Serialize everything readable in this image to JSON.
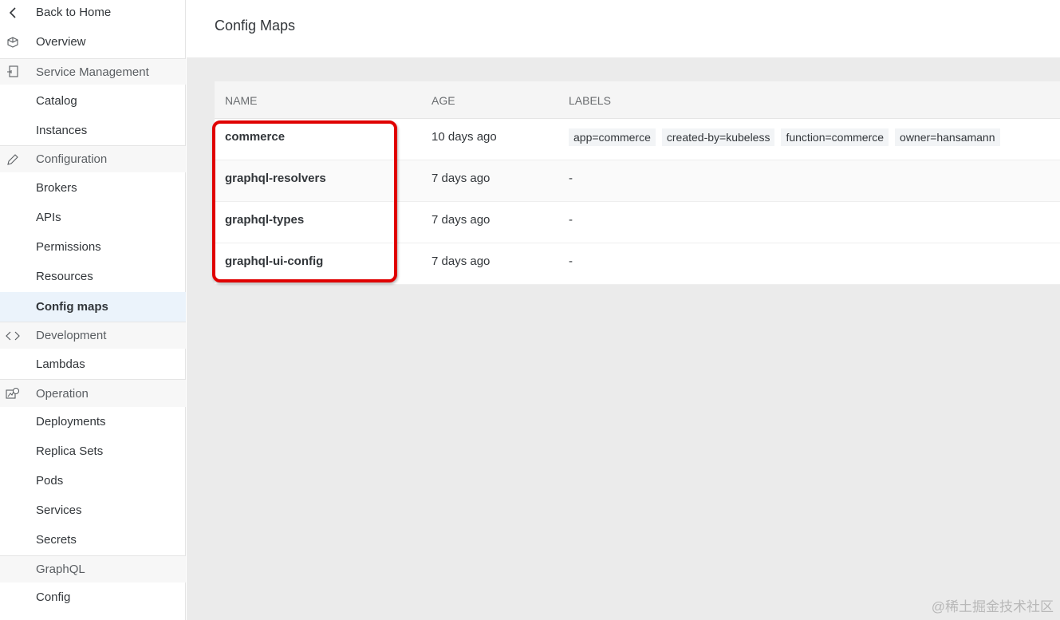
{
  "sidebar": {
    "items": [
      {
        "label": "Back to Home",
        "icon": "chevron-left-icon"
      },
      {
        "label": "Overview",
        "icon": "cube-icon"
      },
      {
        "label": "Service Management",
        "icon": "service-icon"
      },
      {
        "label": "Catalog"
      },
      {
        "label": "Instances"
      },
      {
        "label": "Configuration",
        "icon": "edit-icon"
      },
      {
        "label": "Brokers"
      },
      {
        "label": "APIs"
      },
      {
        "label": "Permissions"
      },
      {
        "label": "Resources"
      },
      {
        "label": "Config maps"
      },
      {
        "label": "Development",
        "icon": "code-icon"
      },
      {
        "label": "Lambdas"
      },
      {
        "label": "Operation",
        "icon": "operation-icon"
      },
      {
        "label": "Deployments"
      },
      {
        "label": "Replica Sets"
      },
      {
        "label": "Pods"
      },
      {
        "label": "Services"
      },
      {
        "label": "Secrets"
      },
      {
        "label": "GraphQL"
      },
      {
        "label": "Config"
      }
    ]
  },
  "main": {
    "title": "Config Maps",
    "table": {
      "headers": [
        "NAME",
        "AGE",
        "LABELS"
      ],
      "rows": [
        {
          "name": "commerce",
          "age": "10 days ago",
          "labels": [
            "app=commerce",
            "created-by=kubeless",
            "function=commerce",
            "owner=hansamann"
          ]
        },
        {
          "name": "graphql-resolvers",
          "age": "7 days ago",
          "labels_text": "-"
        },
        {
          "name": "graphql-types",
          "age": "7 days ago",
          "labels_text": "-"
        },
        {
          "name": "graphql-ui-config",
          "age": "7 days ago",
          "labels_text": "-"
        }
      ]
    }
  },
  "watermark": "@稀土掘金技术社区",
  "colors": {
    "highlight": "#e00000",
    "active_bg": "#ebf3fb"
  }
}
